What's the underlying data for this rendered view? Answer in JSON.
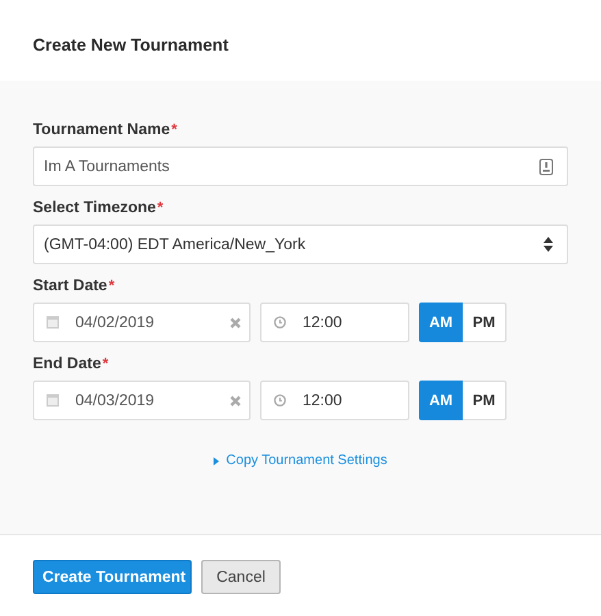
{
  "dialog": {
    "title": "Create New Tournament"
  },
  "fields": [
    {
      "kind": "text",
      "label": "Tournament Name",
      "required_mark": "*",
      "value": "Im A Tournaments"
    },
    {
      "kind": "select",
      "label": "Select Timezone",
      "required_mark": "*",
      "value": "(GMT-04:00) EDT America/New_York"
    },
    {
      "kind": "datetime",
      "label": "Start Date",
      "required_mark": "*",
      "date": "04/02/2019",
      "time": "12:00",
      "meridiem": [
        {
          "label": "AM",
          "selected": true
        },
        {
          "label": "PM",
          "selected": false
        }
      ]
    },
    {
      "kind": "datetime",
      "label": "End Date",
      "required_mark": "*",
      "date": "04/03/2019",
      "time": "12:00",
      "meridiem": [
        {
          "label": "AM",
          "selected": true
        },
        {
          "label": "PM",
          "selected": false
        }
      ]
    }
  ],
  "link": {
    "label": "Copy Tournament Settings"
  },
  "buttons": [
    {
      "kind": "primary",
      "label": "Create Tournament"
    },
    {
      "kind": "secondary",
      "label": "Cancel"
    }
  ]
}
